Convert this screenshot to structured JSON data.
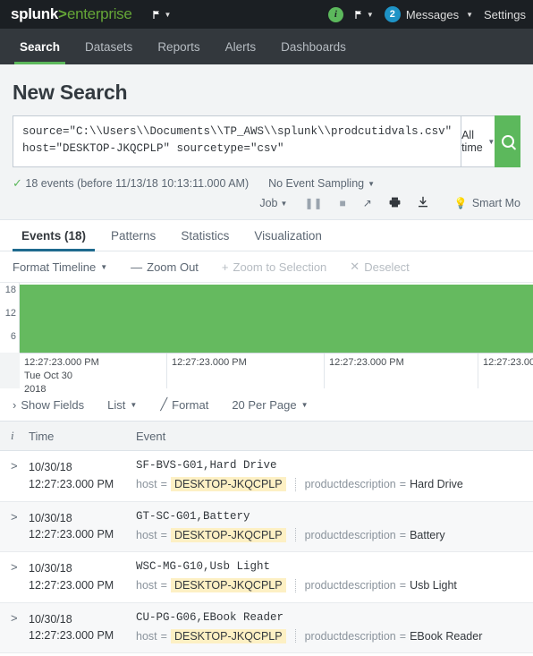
{
  "appbar": {
    "logo_splunk": "splunk",
    "logo_gt": ">",
    "logo_enterprise": "enterprise",
    "flag_icon": "flag-dropdown-icon",
    "info_icon_label": "i",
    "messages_badge": "2",
    "messages_label": "Messages",
    "settings_label": "Settings"
  },
  "nav": {
    "items": [
      {
        "label": "Search",
        "active": true
      },
      {
        "label": "Datasets",
        "active": false
      },
      {
        "label": "Reports",
        "active": false
      },
      {
        "label": "Alerts",
        "active": false
      },
      {
        "label": "Dashboards",
        "active": false
      }
    ]
  },
  "page": {
    "title": "New Search"
  },
  "search": {
    "query_line1": "source=\"C:\\\\Users\\\\Documents\\\\TP_AWS\\\\splunk\\\\prodcutidvals.csv\"",
    "query_line2": "host=\"DESKTOP-JKQCPLP\"  sourcetype=\"csv\"",
    "time_range": "All time",
    "search_button_icon": "search-icon"
  },
  "status": {
    "check": "✓",
    "events_text": "18 events (before 11/13/18 10:13:11.000 AM)",
    "sampling_label": "No Event Sampling",
    "job_label": "Job",
    "pause_icon": "pause-icon",
    "stop_icon": "stop-icon",
    "share_icon": "share-icon",
    "print_icon": "print-icon",
    "export_icon": "export-icon",
    "smart_mode_label": "Smart Mo"
  },
  "result_tabs": [
    {
      "label": "Events (18)",
      "active": true
    },
    {
      "label": "Patterns",
      "active": false
    },
    {
      "label": "Statistics",
      "active": false
    },
    {
      "label": "Visualization",
      "active": false
    }
  ],
  "timeline_toolbar": {
    "format_timeline": "Format Timeline",
    "zoom_out": "Zoom Out",
    "zoom_to_selection": "Zoom to Selection",
    "deselect": "Deselect"
  },
  "chart_data": {
    "type": "bar",
    "title": "",
    "xlabel": "",
    "ylabel": "",
    "y_ticks": [
      "18",
      "12",
      "6"
    ],
    "ylim": [
      0,
      20
    ],
    "categories": [
      "12:27:23.000 PM Tue Oct 30 2018",
      "12:27:23.000 PM",
      "12:27:23.000 PM",
      "12:27:23.00"
    ],
    "values": [
      18,
      18,
      18,
      18
    ],
    "x_tick_labels": [
      {
        "time": "12:27:23.000 PM",
        "day": "Tue Oct 30",
        "year": "2018"
      },
      {
        "time": "12:27:23.000 PM",
        "day": "",
        "year": ""
      },
      {
        "time": "12:27:23.000 PM",
        "day": "",
        "year": ""
      },
      {
        "time": "12:27:23.00",
        "day": "",
        "year": ""
      }
    ],
    "bar_color": "#65ba5f",
    "grid": false,
    "legend": "none"
  },
  "list_controls": {
    "show_fields": "Show Fields",
    "list_mode": "List",
    "format": "Format",
    "per_page": "20 Per Page"
  },
  "events_table": {
    "columns": [
      "i",
      "Time",
      "Event"
    ],
    "rows": [
      {
        "expand": ">",
        "date": "10/30/18",
        "time": "12:27:23.000 PM",
        "raw": "SF-BVS-G01,Hard Drive",
        "host_key": "host",
        "host_value": "DESKTOP-JKQCPLP",
        "desc_key": "productdescription",
        "desc_value": "Hard Drive"
      },
      {
        "expand": ">",
        "date": "10/30/18",
        "time": "12:27:23.000 PM",
        "raw": "GT-SC-G01,Battery",
        "host_key": "host",
        "host_value": "DESKTOP-JKQCPLP",
        "desc_key": "productdescription",
        "desc_value": "Battery"
      },
      {
        "expand": ">",
        "date": "10/30/18",
        "time": "12:27:23.000 PM",
        "raw": "WSC-MG-G10,Usb Light",
        "host_key": "host",
        "host_value": "DESKTOP-JKQCPLP",
        "desc_key": "productdescription",
        "desc_value": "Usb Light"
      },
      {
        "expand": ">",
        "date": "10/30/18",
        "time": "12:27:23.000 PM",
        "raw": "CU-PG-G06,EBook Reader",
        "host_key": "host",
        "host_value": "DESKTOP-JKQCPLP",
        "desc_key": "productdescription",
        "desc_value": "EBook Reader"
      }
    ]
  },
  "colors": {
    "splunk_green": "#65a637",
    "appbar_bg": "#1b1f23",
    "nav_bg": "#33383d",
    "accent_blue": "#1e93c6",
    "tab_underline": "#1e6a8e",
    "bar_green": "#65ba5f",
    "highlight": "#fdf0c4"
  }
}
